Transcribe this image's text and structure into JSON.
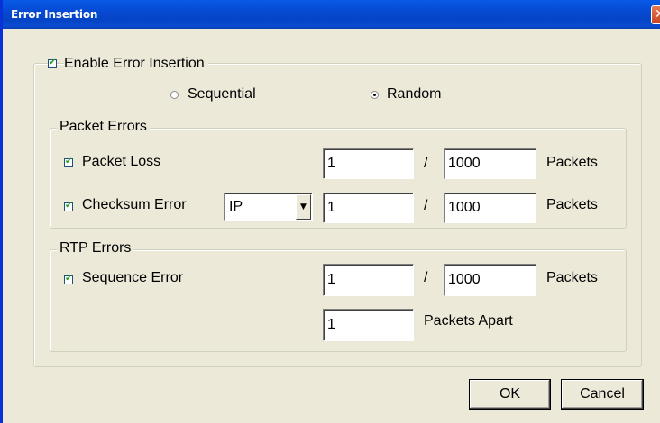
{
  "window": {
    "title": "Error Insertion",
    "close_glyph": "✕"
  },
  "enable": {
    "label": "Enable Error Insertion",
    "checked": true
  },
  "mode": {
    "sequential_label": "Sequential",
    "random_label": "Random",
    "selected": "Random"
  },
  "packet_errors": {
    "title": "Packet Errors",
    "packet_loss": {
      "label": "Packet Loss",
      "checked": true,
      "numerator": "1",
      "denominator": "1000",
      "unit": "Packets"
    },
    "checksum": {
      "label": "Checksum Error",
      "checked": true,
      "protocol": "IP",
      "numerator": "1",
      "denominator": "1000",
      "unit": "Packets"
    },
    "separator": "/"
  },
  "rtp_errors": {
    "title": "RTP Errors",
    "sequence": {
      "label": "Sequence Error",
      "checked": true,
      "numerator": "1",
      "denominator": "1000",
      "unit": "Packets",
      "apart_value": "1",
      "apart_label": "Packets Apart"
    },
    "separator": "/"
  },
  "buttons": {
    "ok": "OK",
    "cancel": "Cancel"
  },
  "icons": {
    "checkmark": "check-icon",
    "dropdown": "chevron-down-icon",
    "close": "close-icon"
  }
}
